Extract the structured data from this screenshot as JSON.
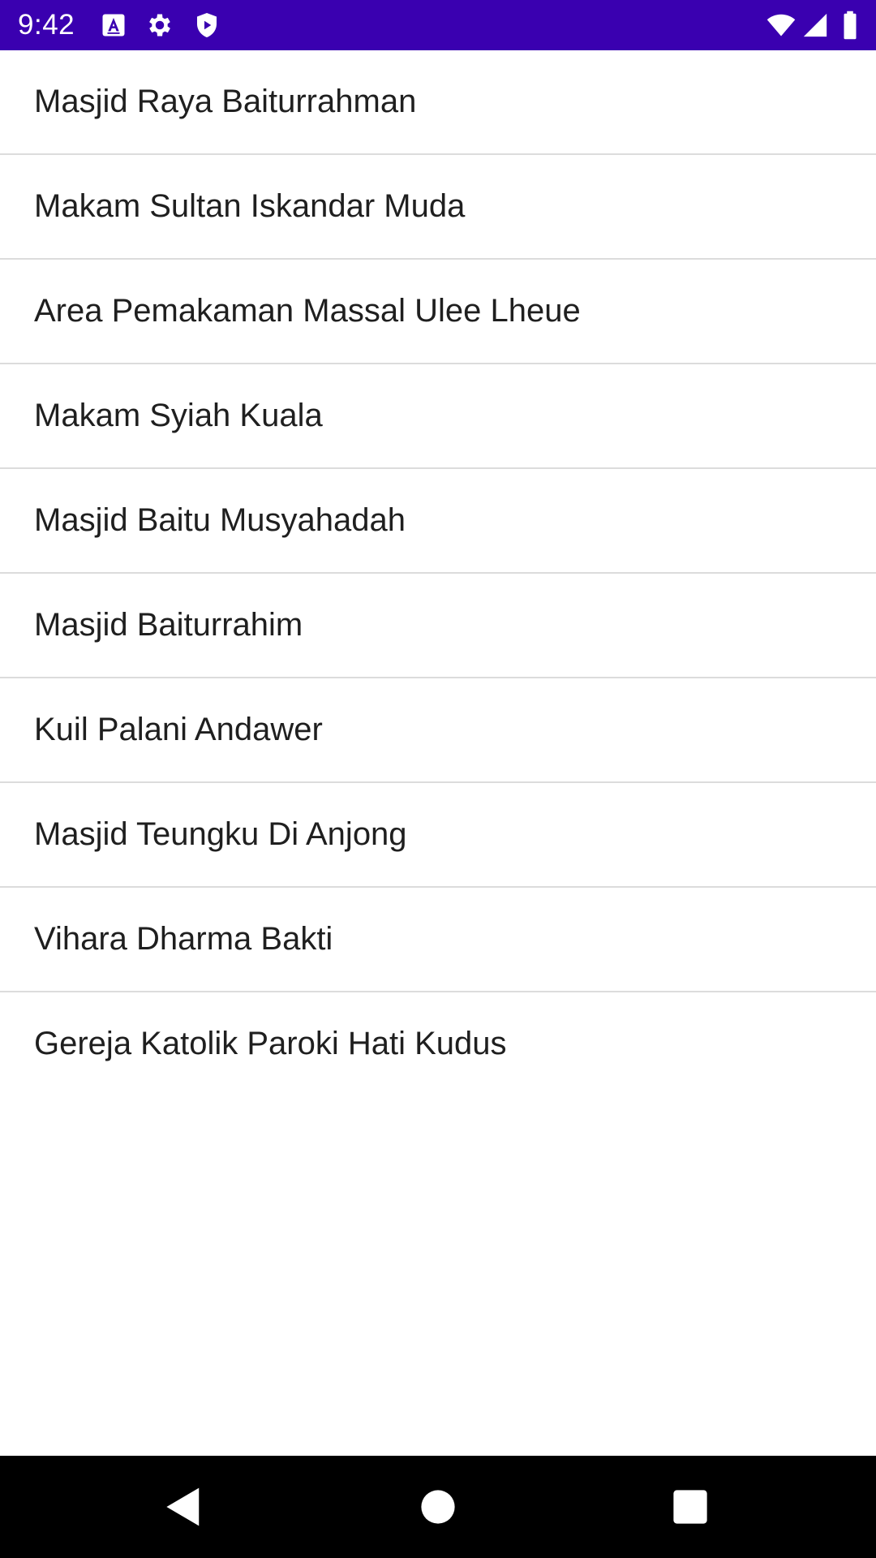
{
  "status_bar": {
    "time": "9:42",
    "background_color": "#3a00b0",
    "left_icons": [
      "a-letter-icon",
      "gear-icon",
      "shield-play-icon"
    ],
    "right_icons": [
      "wifi-icon",
      "signal-icon",
      "battery-icon"
    ]
  },
  "list": {
    "items": [
      {
        "label": "Masjid Raya Baiturrahman"
      },
      {
        "label": "Makam Sultan Iskandar Muda"
      },
      {
        "label": "Area Pemakaman Massal Ulee Lheue"
      },
      {
        "label": "Makam Syiah Kuala"
      },
      {
        "label": "Masjid Baitu Musyahadah"
      },
      {
        "label": "Masjid Baiturrahim"
      },
      {
        "label": "Kuil Palani Andawer"
      },
      {
        "label": "Masjid Teungku Di Anjong"
      },
      {
        "label": "Vihara Dharma Bakti"
      },
      {
        "label": "Gereja Katolik Paroki Hati Kudus"
      }
    ]
  },
  "nav_bar": {
    "buttons": [
      "back-icon",
      "home-icon",
      "recents-icon"
    ]
  }
}
